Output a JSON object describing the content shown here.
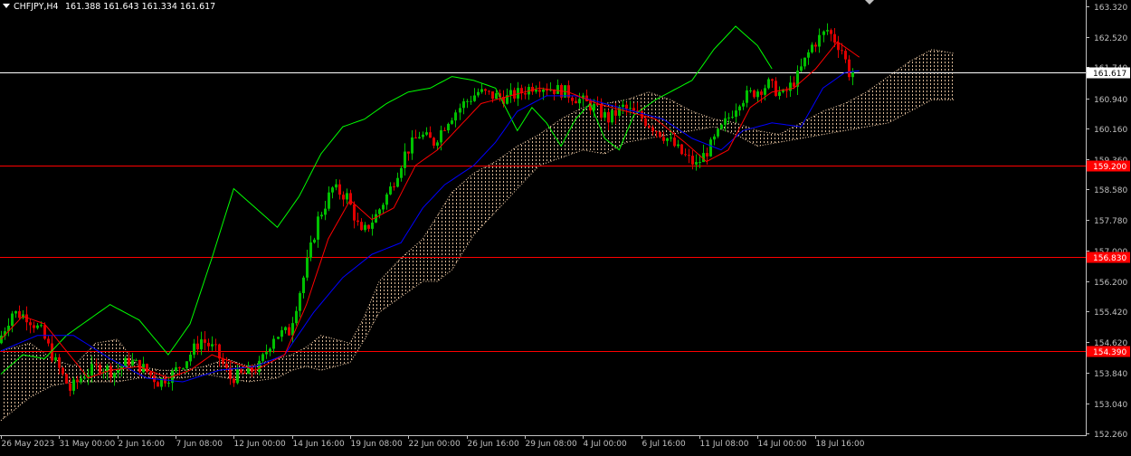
{
  "header": {
    "symbol": "CHFJPY,H4",
    "ohlc": "161.388 161.643 161.334 161.617"
  },
  "colors": {
    "background": "#000000",
    "bull_candle": "#00c000",
    "bear_candle": "#e00000",
    "tenkan": "#ff0000",
    "kijun": "#0000ff",
    "chikou": "#00ff00",
    "cloud": "#ffd8b0",
    "level_line": "#ff0000",
    "price_line": "#ffffff",
    "axis_text": "#c0c0c0"
  },
  "chart_data": {
    "type": "candlestick",
    "symbol": "CHFJPY",
    "timeframe": "H4",
    "ylim": [
      152.22,
      163.48
    ],
    "y_ticks": [
      163.32,
      162.52,
      161.74,
      160.94,
      160.16,
      159.36,
      158.58,
      157.78,
      157.0,
      156.2,
      155.42,
      154.62,
      153.84,
      153.04,
      152.26
    ],
    "y_tick_labels": [
      "163.320",
      "162.520",
      "161.740",
      "160.940",
      "160.160",
      "159.360",
      "158.580",
      "157.780",
      "157.000",
      "156.200",
      "155.420",
      "154.620",
      "153.840",
      "153.040",
      "152.260"
    ],
    "x_tick_labels": [
      "26 May 2023",
      "31 May 00:00",
      "2 Jun 16:00",
      "7 Jun 08:00",
      "12 Jun 00:00",
      "14 Jun 16:00",
      "19 Jun 08:00",
      "22 Jun 00:00",
      "26 Jun 16:00",
      "29 Jun 08:00",
      "4 Jul 00:00",
      "6 Jul 16:00",
      "11 Jul 08:00",
      "14 Jul 00:00",
      "18 Jul 16:00"
    ],
    "x_tick_bars": [
      0,
      16,
      32,
      48,
      64,
      80,
      96,
      112,
      128,
      144,
      160,
      176,
      192,
      208,
      224
    ],
    "current_price": 161.617,
    "current_price_label": "161.617",
    "horizontal_levels": [
      {
        "value": 159.2,
        "label": "159.200"
      },
      {
        "value": 156.83,
        "label": "156.830"
      },
      {
        "value": 154.39,
        "label": "154.390"
      }
    ],
    "price_path": [
      [
        0,
        154.6
      ],
      [
        4,
        155.4
      ],
      [
        8,
        155.3
      ],
      [
        12,
        154.9
      ],
      [
        16,
        154.1
      ],
      [
        20,
        153.4
      ],
      [
        24,
        153.8
      ],
      [
        28,
        154.0
      ],
      [
        32,
        153.85
      ],
      [
        36,
        154.15
      ],
      [
        40,
        153.95
      ],
      [
        44,
        153.6
      ],
      [
        48,
        153.8
      ],
      [
        52,
        154.2
      ],
      [
        56,
        154.7
      ],
      [
        60,
        154.4
      ],
      [
        64,
        153.7
      ],
      [
        68,
        153.8
      ],
      [
        72,
        154.0
      ],
      [
        76,
        154.8
      ],
      [
        80,
        154.9
      ],
      [
        84,
        156.3
      ],
      [
        88,
        157.8
      ],
      [
        92,
        158.6
      ],
      [
        96,
        158.4
      ],
      [
        100,
        157.4
      ],
      [
        104,
        157.9
      ],
      [
        108,
        158.6
      ],
      [
        112,
        159.5
      ],
      [
        116,
        160.0
      ],
      [
        120,
        159.8
      ],
      [
        124,
        160.4
      ],
      [
        128,
        160.8
      ],
      [
        132,
        161.1
      ],
      [
        136,
        161.0
      ],
      [
        140,
        160.95
      ],
      [
        144,
        161.1
      ],
      [
        148,
        161.3
      ],
      [
        152,
        161.2
      ],
      [
        156,
        161.1
      ],
      [
        160,
        160.9
      ],
      [
        164,
        160.7
      ],
      [
        168,
        160.4
      ],
      [
        172,
        160.7
      ],
      [
        176,
        160.5
      ],
      [
        180,
        160.2
      ],
      [
        184,
        159.9
      ],
      [
        188,
        159.5
      ],
      [
        192,
        159.2
      ],
      [
        196,
        159.7
      ],
      [
        200,
        160.3
      ],
      [
        204,
        160.9
      ],
      [
        208,
        161.1
      ],
      [
        212,
        161.3
      ],
      [
        216,
        161.0
      ],
      [
        220,
        161.5
      ],
      [
        224,
        162.3
      ],
      [
        228,
        162.7
      ],
      [
        232,
        162.2
      ],
      [
        234,
        161.6
      ]
    ],
    "tenkan_path": [
      [
        0,
        154.7
      ],
      [
        6,
        155.3
      ],
      [
        12,
        155.1
      ],
      [
        18,
        154.4
      ],
      [
        24,
        153.7
      ],
      [
        30,
        153.9
      ],
      [
        38,
        154.0
      ],
      [
        46,
        153.7
      ],
      [
        52,
        153.9
      ],
      [
        58,
        154.3
      ],
      [
        64,
        154.1
      ],
      [
        70,
        153.9
      ],
      [
        78,
        154.3
      ],
      [
        84,
        155.6
      ],
      [
        90,
        157.3
      ],
      [
        96,
        158.3
      ],
      [
        102,
        157.8
      ],
      [
        108,
        158.1
      ],
      [
        114,
        159.2
      ],
      [
        120,
        159.6
      ],
      [
        126,
        160.2
      ],
      [
        132,
        160.8
      ],
      [
        140,
        161.0
      ],
      [
        148,
        161.2
      ],
      [
        156,
        161.1
      ],
      [
        164,
        160.8
      ],
      [
        172,
        160.6
      ],
      [
        180,
        160.4
      ],
      [
        188,
        159.8
      ],
      [
        194,
        159.3
      ],
      [
        200,
        159.6
      ],
      [
        206,
        160.7
      ],
      [
        212,
        161.1
      ],
      [
        218,
        161.2
      ],
      [
        224,
        161.7
      ],
      [
        230,
        162.4
      ],
      [
        236,
        162.0
      ]
    ],
    "kijun_path": [
      [
        0,
        154.4
      ],
      [
        10,
        154.8
      ],
      [
        20,
        154.8
      ],
      [
        30,
        154.2
      ],
      [
        40,
        153.7
      ],
      [
        50,
        153.6
      ],
      [
        60,
        153.9
      ],
      [
        70,
        154.0
      ],
      [
        78,
        154.3
      ],
      [
        86,
        155.4
      ],
      [
        94,
        156.3
      ],
      [
        102,
        156.9
      ],
      [
        110,
        157.2
      ],
      [
        116,
        158.1
      ],
      [
        122,
        158.7
      ],
      [
        130,
        159.2
      ],
      [
        136,
        159.8
      ],
      [
        142,
        160.6
      ],
      [
        150,
        161.0
      ],
      [
        158,
        161.0
      ],
      [
        166,
        160.8
      ],
      [
        174,
        160.6
      ],
      [
        182,
        160.4
      ],
      [
        190,
        159.9
      ],
      [
        198,
        159.6
      ],
      [
        204,
        160.1
      ],
      [
        212,
        160.3
      ],
      [
        220,
        160.2
      ],
      [
        226,
        161.2
      ],
      [
        232,
        161.6
      ],
      [
        236,
        161.65
      ]
    ],
    "chikou_path": [
      [
        0,
        153.8
      ],
      [
        6,
        154.3
      ],
      [
        12,
        154.2
      ],
      [
        18,
        154.8
      ],
      [
        24,
        155.2
      ],
      [
        30,
        155.6
      ],
      [
        38,
        155.2
      ],
      [
        46,
        154.3
      ],
      [
        52,
        155.1
      ],
      [
        58,
        156.8
      ],
      [
        64,
        158.6
      ],
      [
        70,
        158.1
      ],
      [
        76,
        157.6
      ],
      [
        82,
        158.4
      ],
      [
        88,
        159.5
      ],
      [
        94,
        160.2
      ],
      [
        100,
        160.4
      ],
      [
        106,
        160.8
      ],
      [
        112,
        161.1
      ],
      [
        118,
        161.2
      ],
      [
        124,
        161.5
      ],
      [
        130,
        161.4
      ],
      [
        136,
        161.2
      ],
      [
        142,
        160.1
      ],
      [
        146,
        160.7
      ],
      [
        150,
        160.3
      ],
      [
        154,
        159.7
      ],
      [
        158,
        160.4
      ],
      [
        162,
        160.8
      ],
      [
        166,
        159.9
      ],
      [
        170,
        159.6
      ],
      [
        174,
        160.5
      ],
      [
        180,
        160.9
      ],
      [
        186,
        161.2
      ],
      [
        190,
        161.4
      ],
      [
        196,
        162.2
      ],
      [
        202,
        162.8
      ],
      [
        208,
        162.3
      ],
      [
        212,
        161.7
      ]
    ],
    "cloud_top": [
      [
        0,
        154.4
      ],
      [
        8,
        154.6
      ],
      [
        14,
        154.2
      ],
      [
        20,
        154.0
      ],
      [
        26,
        154.6
      ],
      [
        32,
        154.7
      ],
      [
        38,
        154.0
      ],
      [
        44,
        153.9
      ],
      [
        50,
        153.9
      ],
      [
        56,
        154.0
      ],
      [
        62,
        154.2
      ],
      [
        68,
        154.0
      ],
      [
        76,
        154.2
      ],
      [
        80,
        154.3
      ],
      [
        84,
        154.5
      ],
      [
        88,
        154.8
      ],
      [
        96,
        154.6
      ],
      [
        100,
        155.3
      ],
      [
        104,
        156.2
      ],
      [
        110,
        156.8
      ],
      [
        116,
        157.3
      ],
      [
        120,
        157.9
      ],
      [
        124,
        158.5
      ],
      [
        130,
        159.0
      ],
      [
        136,
        159.3
      ],
      [
        142,
        159.7
      ],
      [
        148,
        160.0
      ],
      [
        154,
        160.4
      ],
      [
        160,
        160.7
      ],
      [
        166,
        160.8
      ],
      [
        172,
        160.9
      ],
      [
        178,
        161.1
      ],
      [
        184,
        160.9
      ],
      [
        190,
        160.6
      ],
      [
        196,
        160.4
      ],
      [
        202,
        160.3
      ],
      [
        208,
        160.1
      ],
      [
        214,
        160.0
      ],
      [
        220,
        160.3
      ],
      [
        226,
        160.6
      ],
      [
        232,
        160.8
      ],
      [
        238,
        161.1
      ],
      [
        244,
        161.5
      ],
      [
        250,
        161.9
      ],
      [
        256,
        162.2
      ],
      [
        262,
        162.1
      ]
    ],
    "cloud_bottom": [
      [
        0,
        152.6
      ],
      [
        8,
        153.2
      ],
      [
        14,
        153.5
      ],
      [
        20,
        153.6
      ],
      [
        26,
        153.6
      ],
      [
        32,
        153.6
      ],
      [
        38,
        153.7
      ],
      [
        44,
        153.7
      ],
      [
        50,
        153.7
      ],
      [
        56,
        153.8
      ],
      [
        62,
        153.7
      ],
      [
        68,
        153.6
      ],
      [
        76,
        153.7
      ],
      [
        80,
        153.9
      ],
      [
        84,
        154.0
      ],
      [
        88,
        153.9
      ],
      [
        96,
        154.1
      ],
      [
        100,
        154.7
      ],
      [
        104,
        155.4
      ],
      [
        110,
        155.8
      ],
      [
        116,
        156.2
      ],
      [
        120,
        156.2
      ],
      [
        124,
        156.5
      ],
      [
        130,
        157.4
      ],
      [
        136,
        158.0
      ],
      [
        142,
        158.6
      ],
      [
        148,
        159.2
      ],
      [
        154,
        159.4
      ],
      [
        160,
        159.6
      ],
      [
        166,
        159.5
      ],
      [
        172,
        159.8
      ],
      [
        178,
        159.9
      ],
      [
        184,
        160.0
      ],
      [
        190,
        160.1
      ],
      [
        196,
        160.2
      ],
      [
        202,
        160.0
      ],
      [
        208,
        159.7
      ],
      [
        214,
        159.8
      ],
      [
        220,
        159.9
      ],
      [
        226,
        160.0
      ],
      [
        232,
        160.1
      ],
      [
        238,
        160.2
      ],
      [
        244,
        160.3
      ],
      [
        250,
        160.6
      ],
      [
        256,
        160.9
      ],
      [
        262,
        160.9
      ]
    ]
  }
}
